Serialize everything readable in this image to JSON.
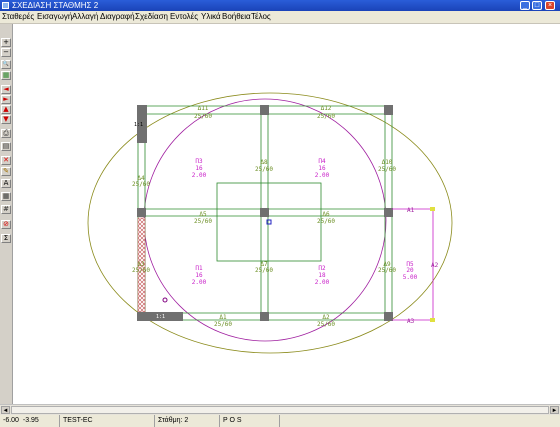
{
  "window": {
    "title": "ΣΧΕΔΙΑΣΗ ΣΤΑΘΜΗΣ 2",
    "min_glyph": "_",
    "max_glyph": "□",
    "close_glyph": "×"
  },
  "menu": [
    "Σταθερές",
    "Εισαγωγή",
    "Αλλαγή",
    "Διαγραφή",
    "Σχεδίαση",
    "Εντολές",
    "Υλικά",
    "Βοήθεια",
    "Τέλος"
  ],
  "toolbar": [
    {
      "icon": "zoom-in-icon",
      "glyph": "+"
    },
    {
      "icon": "zoom-out-icon",
      "glyph": "−"
    },
    {
      "icon": "magnifier-icon",
      "glyph": "🔍"
    },
    {
      "icon": "layers-icon",
      "glyph": "▦"
    },
    {
      "icon": "pan-left-icon",
      "glyph": "◄"
    },
    {
      "icon": "pan-right-icon",
      "glyph": "►"
    },
    {
      "icon": "pan-up-icon",
      "glyph": "▲"
    },
    {
      "icon": "pan-down-icon",
      "glyph": "▼"
    },
    {
      "icon": "print-icon",
      "glyph": "⎙"
    },
    {
      "icon": "document-icon",
      "glyph": "▤"
    },
    {
      "icon": "delete-icon",
      "glyph": "✕"
    },
    {
      "icon": "edit-icon",
      "glyph": "✎"
    },
    {
      "icon": "text-icon",
      "glyph": "A"
    },
    {
      "icon": "table-icon",
      "glyph": "▦"
    },
    {
      "icon": "grid-icon",
      "glyph": "#"
    },
    {
      "icon": "stop-icon",
      "glyph": "⊘"
    },
    {
      "icon": "sum-icon",
      "glyph": "Σ"
    }
  ],
  "colors": {
    "beam": "#2e8b2e",
    "slab": "#c81ec8",
    "column": "#707070",
    "footing_ellipse": "#8a8a1a",
    "circle": "#a020a0",
    "label_beam": "#6b8e23"
  },
  "drawing": {
    "beams": [
      {
        "name": "Δ11",
        "dims": "25/60"
      },
      {
        "name": "Δ12",
        "dims": "25/60"
      },
      {
        "name": "Δ4",
        "dims": "25/60"
      },
      {
        "name": "Δ8",
        "dims": "25/60"
      },
      {
        "name": "Δ10",
        "dims": "25/60"
      },
      {
        "name": "Δ5",
        "dims": "25/60"
      },
      {
        "name": "Δ6",
        "dims": "25/60"
      },
      {
        "name": "Δ3",
        "dims": "25/60"
      },
      {
        "name": "Δ7",
        "dims": "25/60"
      },
      {
        "name": "Δ9",
        "dims": "25/60"
      },
      {
        "name": "Δ1",
        "dims": "25/60"
      },
      {
        "name": "Δ2",
        "dims": "25/60"
      }
    ],
    "slabs": [
      {
        "name": "Π3",
        "thickness": "16",
        "load": "2.00"
      },
      {
        "name": "Π4",
        "thickness": "16",
        "load": "2.00"
      },
      {
        "name": "Π1",
        "thickness": "16",
        "load": "2.00"
      },
      {
        "name": "Π2",
        "thickness": "18",
        "load": "2.00"
      },
      {
        "name": "Π5",
        "thickness": "20",
        "load": "5.00"
      }
    ],
    "cantilever_points": [
      "A1",
      "A2",
      "A3"
    ],
    "scale_marks": [
      "1:1",
      "1:1"
    ]
  },
  "status": {
    "x": "-6.00",
    "y": "-3.95",
    "code": "TEST-EC",
    "level": "Στάθμη: 2",
    "mode": "P O S"
  }
}
